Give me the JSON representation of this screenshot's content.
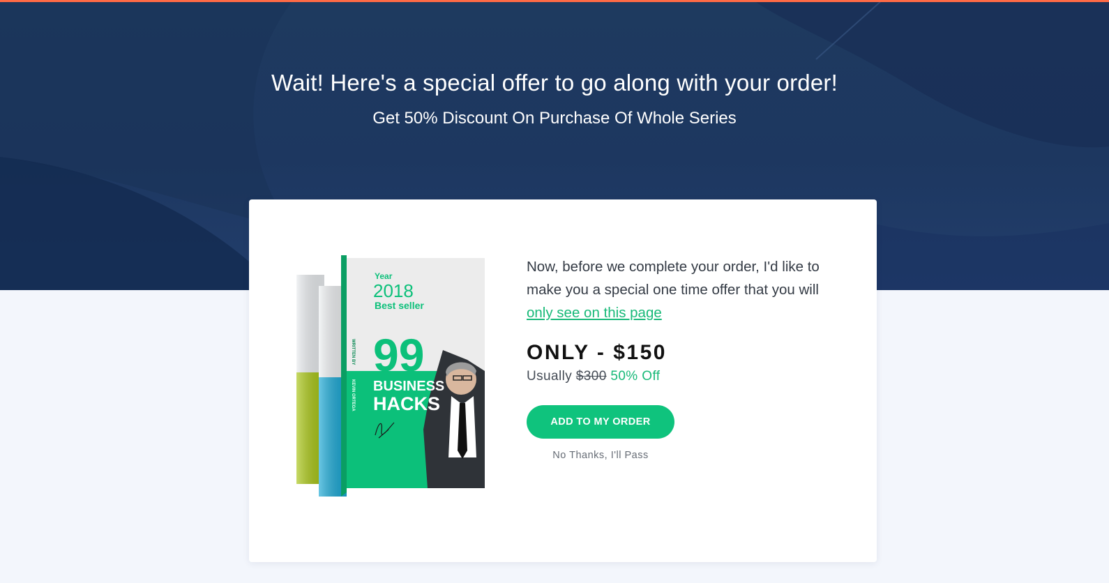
{
  "colors": {
    "accent": "#0fc37d",
    "link": "#17b978",
    "top_bar": "#ff6a45",
    "hero_bg": "#1e3a5f",
    "page_bg": "#f3f6fc"
  },
  "hero": {
    "title": "Wait! Here's a special offer to go along with your order!",
    "subtitle": "Get 50% Discount On Purchase Of Whole Series"
  },
  "offer": {
    "pitch_text": "Now, before we complete your order, I'd like to make you a special one time offer that you will ",
    "pitch_link": "only see on this page",
    "price": "ONLY - $150",
    "usually_label": "Usually",
    "old_price": "$300",
    "discount": "50% Off",
    "cta_label": "ADD TO MY ORDER",
    "decline_label": "No Thanks, I'll Pass"
  },
  "book": {
    "year_label": "Year",
    "year": "2018",
    "badge": "Best seller",
    "number": "99",
    "title_line1": "BUSINESS",
    "title_line2": "HACKS",
    "spine_label": "WRITTEN BY",
    "author": "KEVIN ORTEGA"
  }
}
